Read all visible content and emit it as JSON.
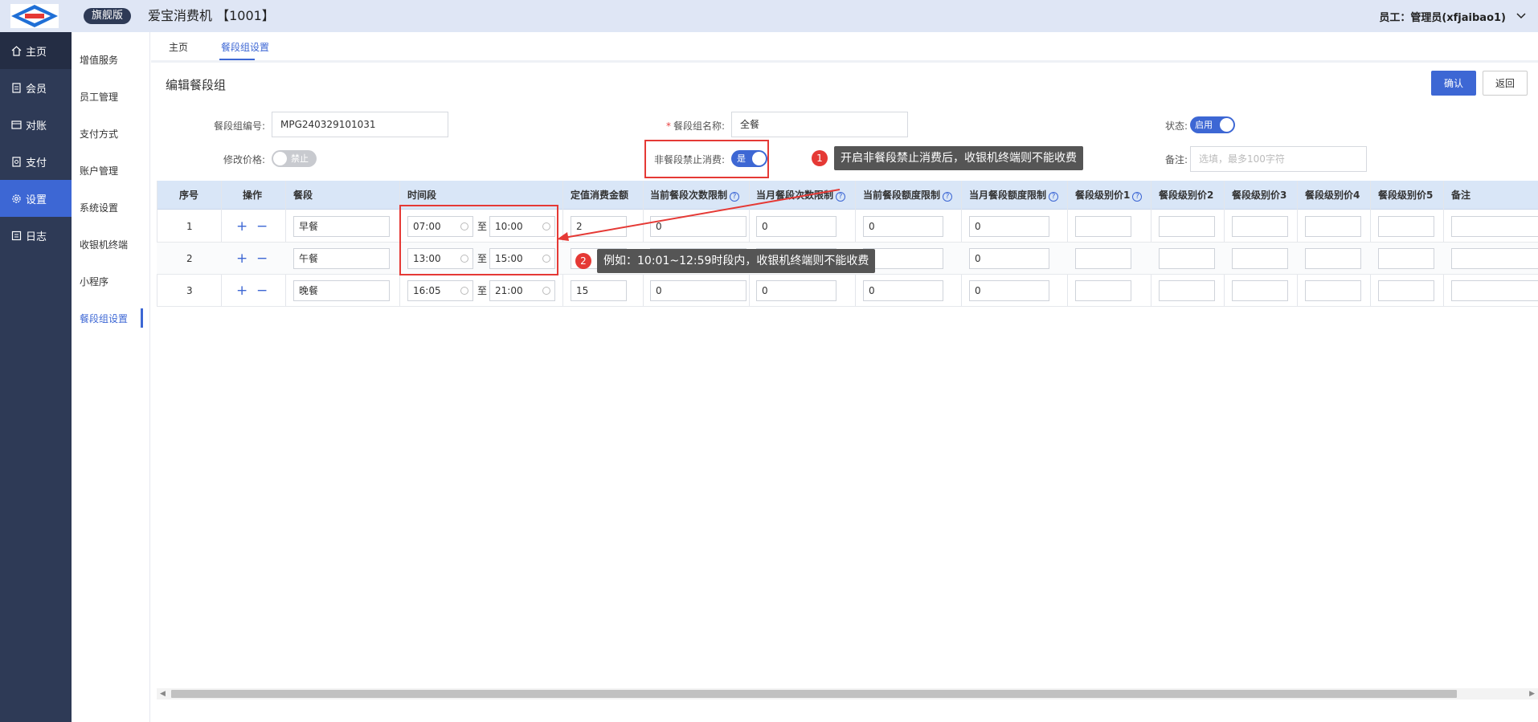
{
  "header": {
    "logo_icon": "aibao-logo",
    "edition": "旗舰版",
    "title": "爱宝消费机 【1001】",
    "user": "员工：管理员(xfjaibao1)"
  },
  "sidebar": {
    "items": [
      {
        "label": "主页",
        "icon": "home-icon"
      },
      {
        "label": "会员",
        "icon": "member-icon"
      },
      {
        "label": "对账",
        "icon": "reconcile-icon"
      },
      {
        "label": "支付",
        "icon": "payment-icon"
      },
      {
        "label": "设置",
        "icon": "gear-icon"
      },
      {
        "label": "日志",
        "icon": "log-icon"
      }
    ],
    "active_color": "#3d67d4"
  },
  "subnav": {
    "items": [
      "增值服务",
      "员工管理",
      "支付方式",
      "账户管理",
      "系统设置",
      "收银机终端",
      "小程序",
      "餐段组设置"
    ]
  },
  "tabs": [
    "主页",
    "餐段组设置"
  ],
  "form": {
    "title": "编辑餐段组",
    "confirm": "确认",
    "back": "返回",
    "code_label": "餐段组编号:",
    "code_value": "MPG240329101031",
    "name_label": "餐段组名称:",
    "name_value": "全餐",
    "status_label": "状态:",
    "status_value": "启用",
    "price_label": "修改价格:",
    "price_value": "禁止",
    "block_label": "非餐段禁止消费:",
    "block_value": "是",
    "remark_label": "备注:",
    "remark_placeholder": "选填，最多100字符"
  },
  "annotations": {
    "one_num": "1",
    "one_text": "开启非餐段禁止消费后，收银机终端则不能收费",
    "two_num": "2",
    "two_text": "例如：10:01~12:59时段内，收银机终端则不能收费",
    "color": "#e53935"
  },
  "table": {
    "headers": [
      "序号",
      "操作",
      "餐段",
      "时间段",
      "定值消费金额",
      "当前餐段次数限制",
      "当月餐段次数限制",
      "当前餐段额度限制",
      "当月餐段额度限制",
      "餐段级别价1",
      "餐段级别价2",
      "餐段级别价3",
      "餐段级别价4",
      "餐段级别价5",
      "备注"
    ],
    "to_label": "至",
    "add": "+",
    "remove": "−",
    "rows": [
      {
        "idx": "1",
        "name": "早餐",
        "start": "07:00",
        "end": "10:00",
        "amount": "2",
        "cur_count": "0",
        "month_count": "0",
        "cur_quota": "0",
        "month_quota": "0"
      },
      {
        "idx": "2",
        "name": "午餐",
        "start": "13:00",
        "end": "15:00",
        "amount": "",
        "cur_count": "",
        "month_count": "",
        "cur_quota": "",
        "month_quota": "0"
      },
      {
        "idx": "3",
        "name": "晚餐",
        "start": "16:05",
        "end": "21:00",
        "amount": "15",
        "cur_count": "0",
        "month_count": "0",
        "cur_quota": "0",
        "month_quota": "0"
      }
    ]
  }
}
